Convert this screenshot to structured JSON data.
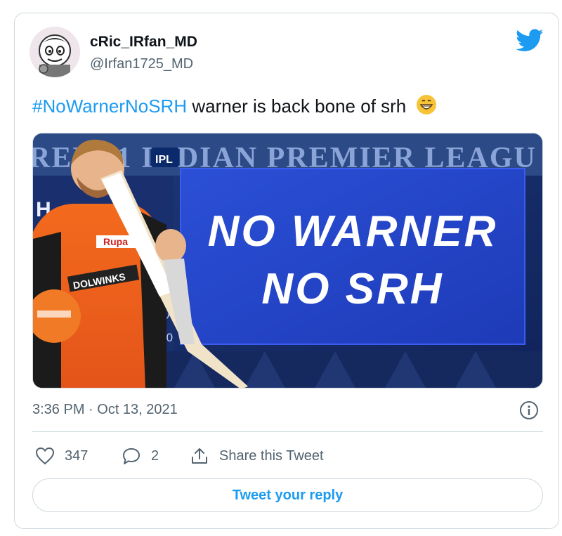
{
  "user": {
    "display_name": "cRic_IRfan_MD",
    "handle": "@Irfan1725_MD"
  },
  "tweet": {
    "hashtag": "#NoWarnerNoSRH",
    "text": " warner is back bone of srh",
    "emoji": "grinning-face-emoji"
  },
  "media": {
    "banner_text": "REM11 INDIAN PREMIER LEAGU",
    "logo_text": "IPL",
    "line1": "NO WARNER",
    "line2": "NO SRH",
    "score_bits": [
      "H",
      "(42)",
      "20-0"
    ],
    "jersey_text": "DOLWINKS",
    "sponsor_text": "Rupa"
  },
  "meta": {
    "timestamp": "3:36 PM · Oct 13, 2021"
  },
  "actions": {
    "likes": "347",
    "replies": "2",
    "share_label": "Share this Tweet"
  },
  "reply_button_label": "Tweet your reply",
  "colors": {
    "accent": "#1d9bf0",
    "text": "#0f1419",
    "muted": "#536471",
    "border": "#cfd9de"
  }
}
